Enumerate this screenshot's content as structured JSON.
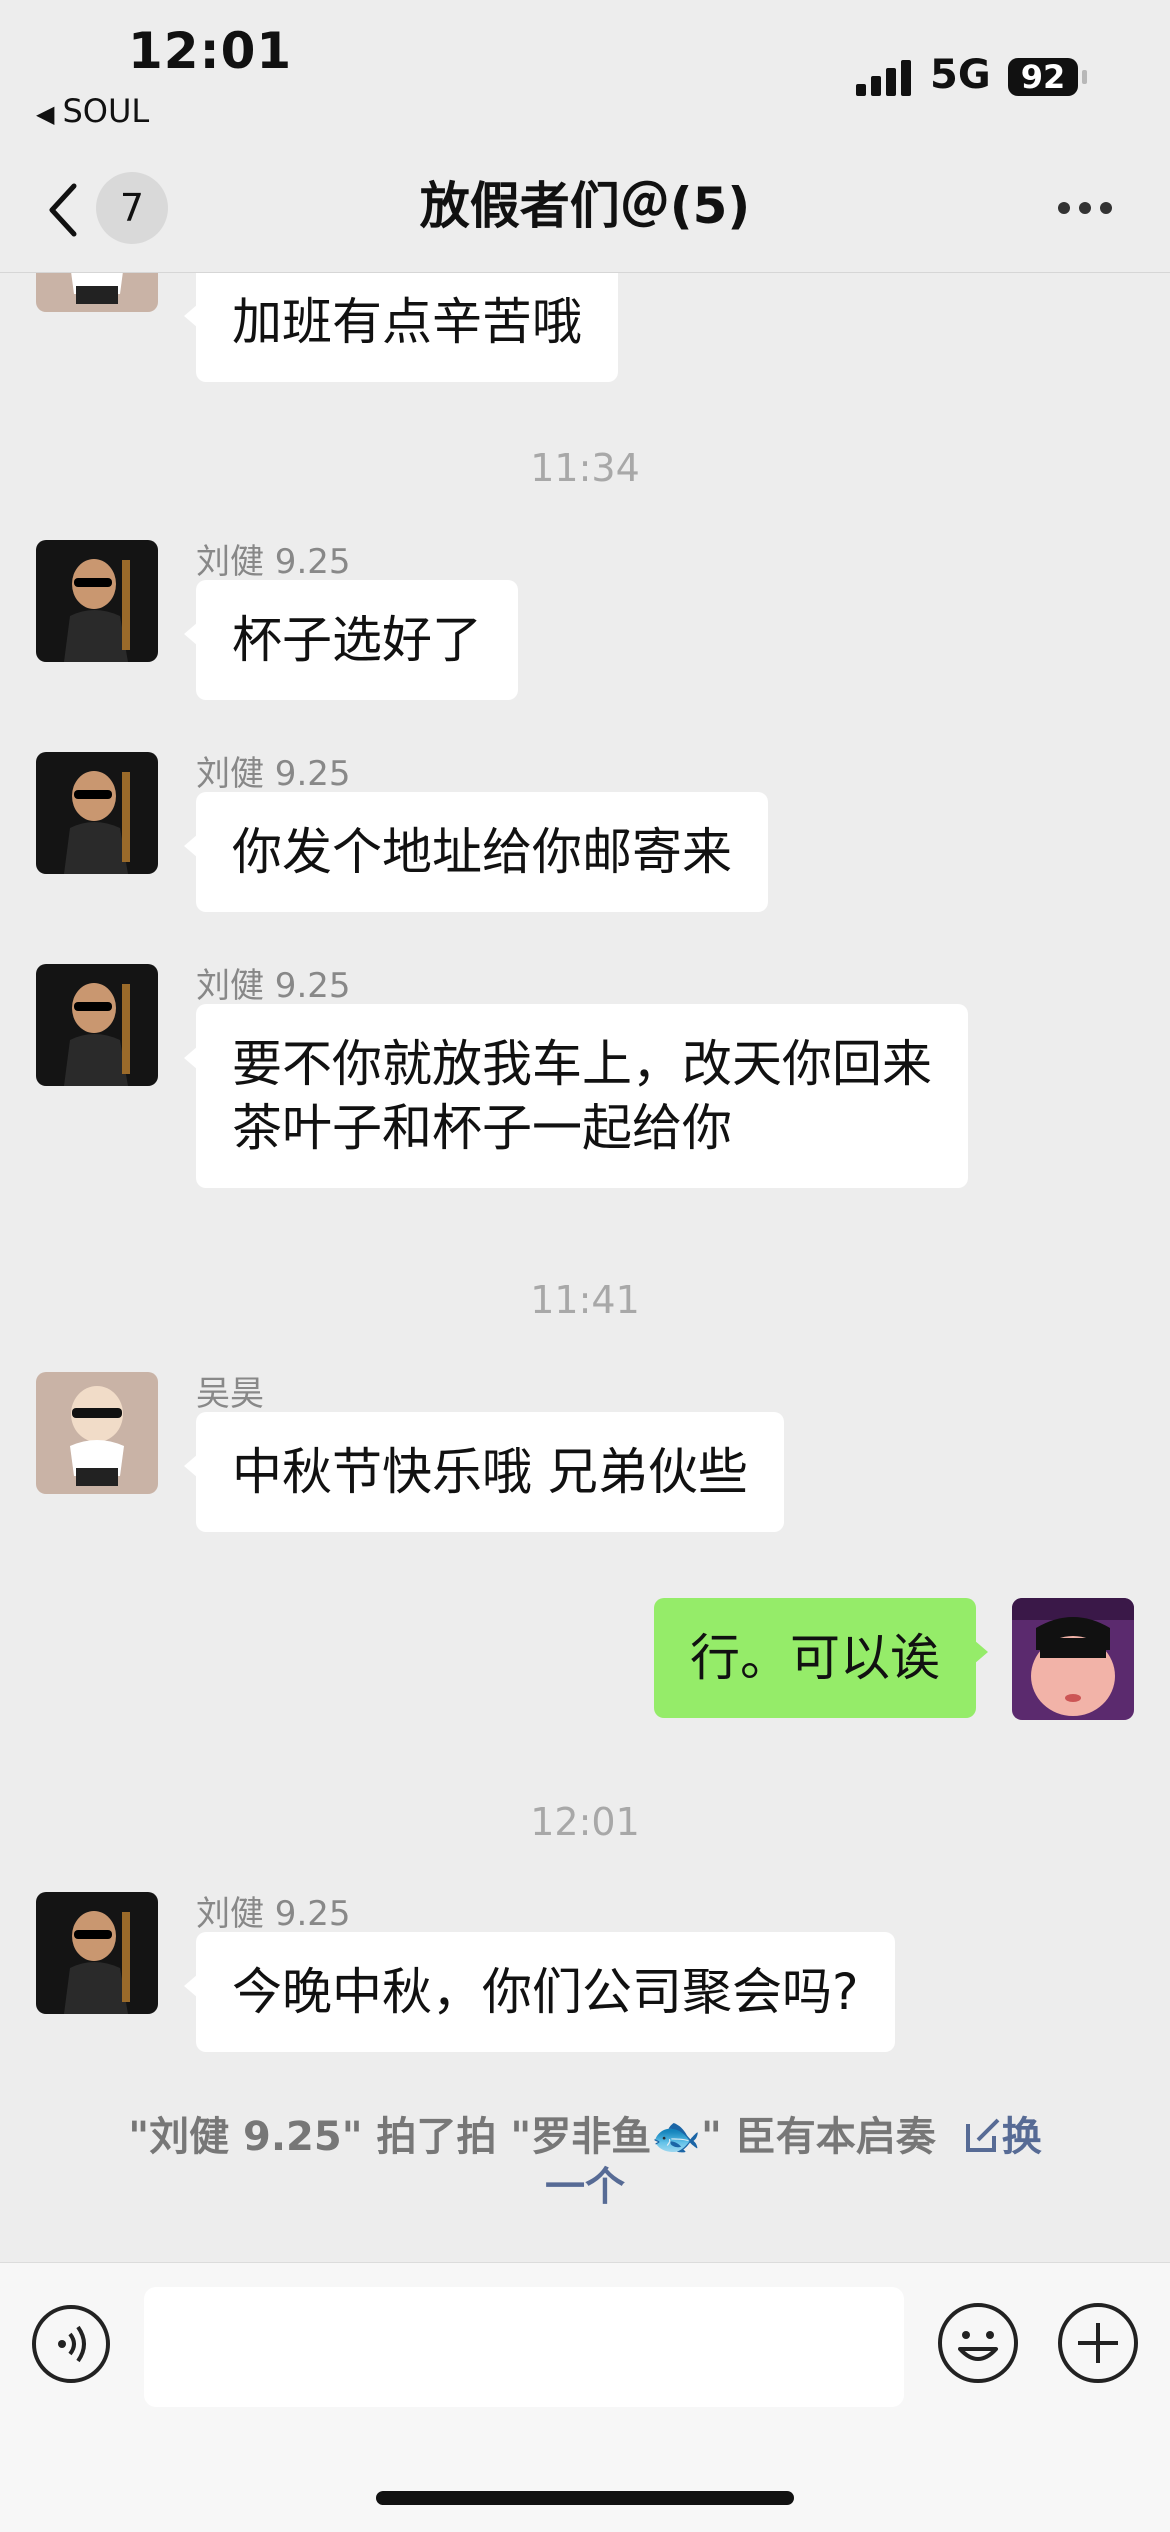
{
  "status_bar": {
    "time": "12:01",
    "back_app": "SOUL",
    "network": "5G",
    "battery": "92"
  },
  "nav": {
    "unread_count": "7",
    "title": "放假者们＠(5)"
  },
  "messages": [
    {
      "text": "加班有点辛苦哦"
    },
    {
      "sender": "刘健 9.25",
      "text": "杯子选好了"
    },
    {
      "sender": "刘健 9.25",
      "text": "你发个地址给你邮寄来"
    },
    {
      "sender": "刘健 9.25",
      "line1": "要不你就放我车上，改天你回来",
      "line2": "茶叶子和杯子一起给你"
    },
    {
      "sender": "吴昊",
      "text": "中秋节快乐哦 兄弟伙些"
    },
    {
      "text": "行。可以诶"
    },
    {
      "sender": "刘健 9.25",
      "text": "今晚中秋，你们公司聚会吗?"
    }
  ],
  "timestamps": [
    "11:34",
    "11:41",
    "12:01"
  ],
  "pat": {
    "text": "\"刘健 9.25\" 拍了拍 \"罗非鱼🐟\" 臣有本启奏",
    "link_part1": "换",
    "link_part2": "一个"
  },
  "input": {
    "placeholder": ""
  },
  "colors": {
    "bg": "#ededed",
    "self_bubble": "#95ec69",
    "link": "#576b95"
  }
}
